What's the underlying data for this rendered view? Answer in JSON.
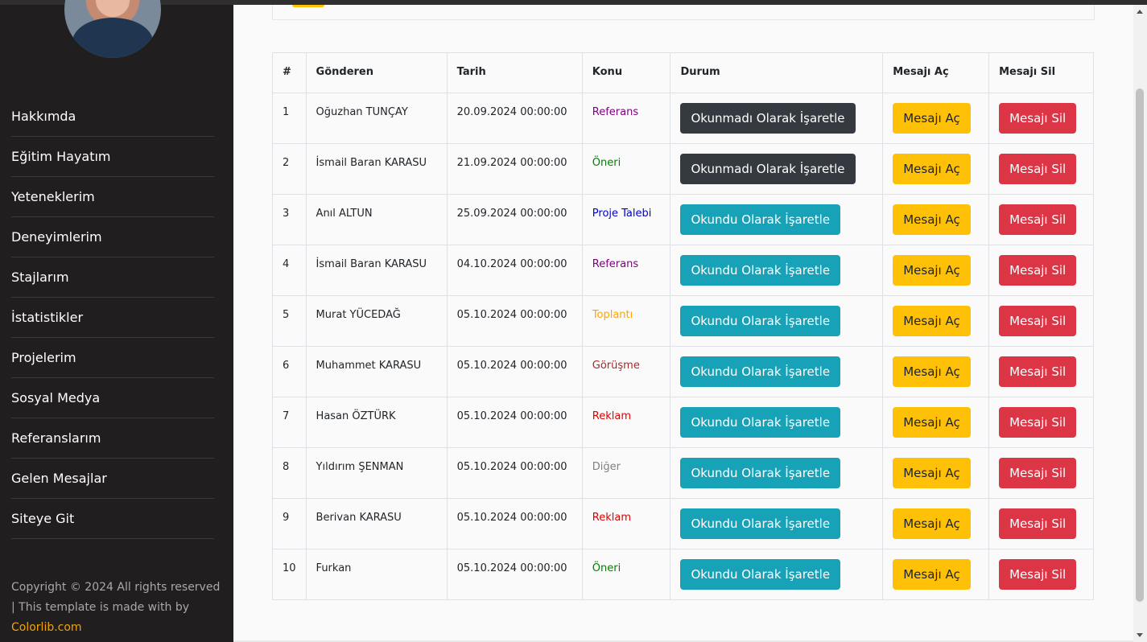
{
  "sidebar": {
    "items": [
      {
        "label": "Hakkımda"
      },
      {
        "label": "Eğitim Hayatım"
      },
      {
        "label": "Yeteneklerim"
      },
      {
        "label": "Deneyimlerim"
      },
      {
        "label": "Stajlarım"
      },
      {
        "label": "İstatistikler"
      },
      {
        "label": "Projelerim"
      },
      {
        "label": "Sosyal Medya"
      },
      {
        "label": "Referanslarım"
      },
      {
        "label": "Gelen Mesajlar"
      },
      {
        "label": "Siteye Git"
      }
    ],
    "footer": {
      "line1": "Copyright © 2024 All rights reserved",
      "line2": "| This template is made with by",
      "brand": "Colorlib.com"
    }
  },
  "table": {
    "headers": [
      "#",
      "Gönderen",
      "Tarih",
      "Konu",
      "Durum",
      "Mesajı Aç",
      "Mesajı Sil"
    ],
    "open_label": "Mesajı Aç",
    "delete_label": "Mesajı Sil",
    "rows": [
      {
        "no": "1",
        "sender": "Oğuzhan TUNÇAY",
        "date": "20.09.2024 00:00:00",
        "subject": "Referans",
        "subject_color": "#800080",
        "status": "Okunmadı Olarak İşaretle",
        "status_style": "dark"
      },
      {
        "no": "2",
        "sender": "İsmail Baran KARASU",
        "date": "21.09.2024 00:00:00",
        "subject": "Öneri",
        "subject_color": "#008000",
        "status": "Okunmadı Olarak İşaretle",
        "status_style": "dark"
      },
      {
        "no": "3",
        "sender": "Anıl ALTUN",
        "date": "25.09.2024 00:00:00",
        "subject": "Proje Talebi",
        "subject_color": "#0000cd",
        "status": "Okundu Olarak İşaretle",
        "status_style": "info"
      },
      {
        "no": "4",
        "sender": "İsmail Baran KARASU",
        "date": "04.10.2024 00:00:00",
        "subject": "Referans",
        "subject_color": "#800080",
        "status": "Okundu Olarak İşaretle",
        "status_style": "info"
      },
      {
        "no": "5",
        "sender": "Murat YÜCEDAĞ",
        "date": "05.10.2024 00:00:00",
        "subject": "Toplantı",
        "subject_color": "#ffa500",
        "status": "Okundu Olarak İşaretle",
        "status_style": "info"
      },
      {
        "no": "6",
        "sender": "Muhammet KARASU",
        "date": "05.10.2024 00:00:00",
        "subject": "Görüşme",
        "subject_color": "#a52a2a",
        "status": "Okundu Olarak İşaretle",
        "status_style": "info"
      },
      {
        "no": "7",
        "sender": "Hasan ÖZTÜRK",
        "date": "05.10.2024 00:00:00",
        "subject": "Reklam",
        "subject_color": "#e00000",
        "status": "Okundu Olarak İşaretle",
        "status_style": "info"
      },
      {
        "no": "8",
        "sender": "Yıldırım ŞENMAN",
        "date": "05.10.2024 00:00:00",
        "subject": "Diğer",
        "subject_color": "#808080",
        "status": "Okundu Olarak İşaretle",
        "status_style": "info"
      },
      {
        "no": "9",
        "sender": "Berivan KARASU",
        "date": "05.10.2024 00:00:00",
        "subject": "Reklam",
        "subject_color": "#e00000",
        "status": "Okundu Olarak İşaretle",
        "status_style": "info"
      },
      {
        "no": "10",
        "sender": "Furkan",
        "date": "05.10.2024 00:00:00",
        "subject": "Öneri",
        "subject_color": "#008000",
        "status": "Okundu Olarak İşaretle",
        "status_style": "info"
      }
    ]
  },
  "colors": {
    "sidebar_bg": "#201e1e",
    "brand": "#f0a30a",
    "btn_dark": "#343a40",
    "btn_info": "#17a2b8",
    "btn_warning": "#ffc107",
    "btn_danger": "#dc3545"
  }
}
